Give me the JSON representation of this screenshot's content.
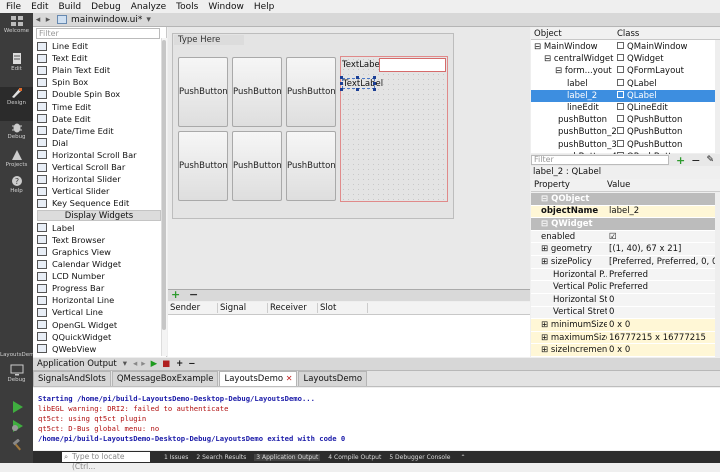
{
  "menu": [
    "File",
    "Edit",
    "Build",
    "Debug",
    "Analyze",
    "Tools",
    "Window",
    "Help"
  ],
  "modes": [
    {
      "label": "Welcome",
      "icon": "welcome-icon"
    },
    {
      "label": "Edit",
      "icon": "edit-icon"
    },
    {
      "label": "Design",
      "icon": "design-icon"
    },
    {
      "label": "Debug",
      "icon": "debug-icon"
    },
    {
      "label": "Projects",
      "icon": "projects-icon"
    },
    {
      "label": "Help",
      "icon": "help-icon"
    }
  ],
  "kit": {
    "project": "LayoutsDemo",
    "config": "Debug"
  },
  "editor": {
    "filename": "mainwindow.ui*"
  },
  "widgetbox": {
    "filter_placeholder": "Filter",
    "items_input": [
      "Line Edit",
      "Text Edit",
      "Plain Text Edit",
      "Spin Box",
      "Double Spin Box",
      "Time Edit",
      "Date Edit",
      "Date/Time Edit",
      "Dial",
      "Horizontal Scroll Bar",
      "Vertical Scroll Bar",
      "Horizontal Slider",
      "Vertical Slider",
      "Key Sequence Edit"
    ],
    "category_display": "Display Widgets",
    "items_display": [
      "Label",
      "Text Browser",
      "Graphics View",
      "Calendar Widget",
      "LCD Number",
      "Progress Bar",
      "Horizontal Line",
      "Vertical Line",
      "OpenGL Widget",
      "QQuickWidget",
      "QWebView"
    ]
  },
  "form": {
    "menu_placeholder": "Type Here",
    "buttons": [
      "PushButton",
      "PushButton",
      "PushButton",
      "PushButton",
      "PushButton",
      "PushButton"
    ],
    "label1": "TextLabel",
    "label2": "TextLabel"
  },
  "signalslot": {
    "add": "+",
    "remove": "−",
    "columns": [
      "Sender",
      "Signal",
      "Receiver",
      "Slot"
    ]
  },
  "object_inspector": {
    "headers": [
      "Object",
      "Class"
    ],
    "rows": [
      {
        "name": "MainWindow",
        "cls": "QMainWindow"
      },
      {
        "name": "centralWidget",
        "cls": "QWidget"
      },
      {
        "name": "form...yout",
        "cls": "QFormLayout"
      },
      {
        "name": "label",
        "cls": "QLabel"
      },
      {
        "name": "label_2",
        "cls": "QLabel",
        "selected": true
      },
      {
        "name": "lineEdit",
        "cls": "QLineEdit"
      },
      {
        "name": "pushButton",
        "cls": "QPushButton"
      },
      {
        "name": "pushButton_2",
        "cls": "QPushButton"
      },
      {
        "name": "pushButton_3",
        "cls": "QPushButton"
      },
      {
        "name": "pushButton_4",
        "cls": "QPushButton"
      }
    ]
  },
  "property_editor": {
    "filter_placeholder": "Filter",
    "class_line": "label_2 : QLabel",
    "headers": [
      "Property",
      "Value"
    ],
    "rows": [
      {
        "name": "QObject",
        "value": "",
        "kind": "grp"
      },
      {
        "name": "objectName",
        "value": "label_2",
        "kind": "y"
      },
      {
        "name": "QWidget",
        "value": "",
        "kind": "grp"
      },
      {
        "name": "enabled",
        "value": "☑",
        "kind": "w"
      },
      {
        "name": "geometry",
        "value": "[(1, 40), 67 x 21]",
        "kind": "w"
      },
      {
        "name": "sizePolicy",
        "value": "[Preferred, Preferred, 0, 0]",
        "kind": "w"
      },
      {
        "name": "Horizontal P...",
        "value": "Preferred",
        "kind": "w"
      },
      {
        "name": "Vertical Policy",
        "value": "Preferred",
        "kind": "w"
      },
      {
        "name": "Horizontal St...",
        "value": "0",
        "kind": "w"
      },
      {
        "name": "Vertical Stret...",
        "value": "0",
        "kind": "w"
      },
      {
        "name": "minimumSize",
        "value": "0 x 0",
        "kind": "y"
      },
      {
        "name": "maximumSize",
        "value": "16777215 x 16777215",
        "kind": "y"
      },
      {
        "name": "sizeIncrement",
        "value": "0 x 0",
        "kind": "y"
      }
    ]
  },
  "output": {
    "title": "Application Output",
    "tabs": [
      "SignalsAndSlots",
      "QMessageBoxExample",
      "LayoutsDemo",
      "LayoutsDemo"
    ],
    "lines": [
      {
        "text": "Starting /home/pi/build-LayoutsDemo-Desktop-Debug/LayoutsDemo...",
        "color": "blue"
      },
      {
        "text": "libEGL warning: DRI2: failed to authenticate",
        "color": "red"
      },
      {
        "text": "qt5ct: using qt5ct plugin",
        "color": "red"
      },
      {
        "text": "qt5ct: D-Bus global menu: no",
        "color": "red"
      },
      {
        "text": "/home/pi/build-LayoutsDemo-Desktop-Debug/LayoutsDemo exited with code 0",
        "color": "blue"
      }
    ]
  },
  "statusbar": {
    "locator_placeholder": "Type to locate (Ctrl...",
    "items": [
      "1 Issues",
      "2 Search Results",
      "3 Application Output",
      "4 Compile Output",
      "5 Debugger Console"
    ]
  },
  "colors": {
    "selection": "#3d8ee0",
    "modebar": "#3c3c3c",
    "statusbar": "#2c2c2c",
    "run": "#39a039"
  }
}
